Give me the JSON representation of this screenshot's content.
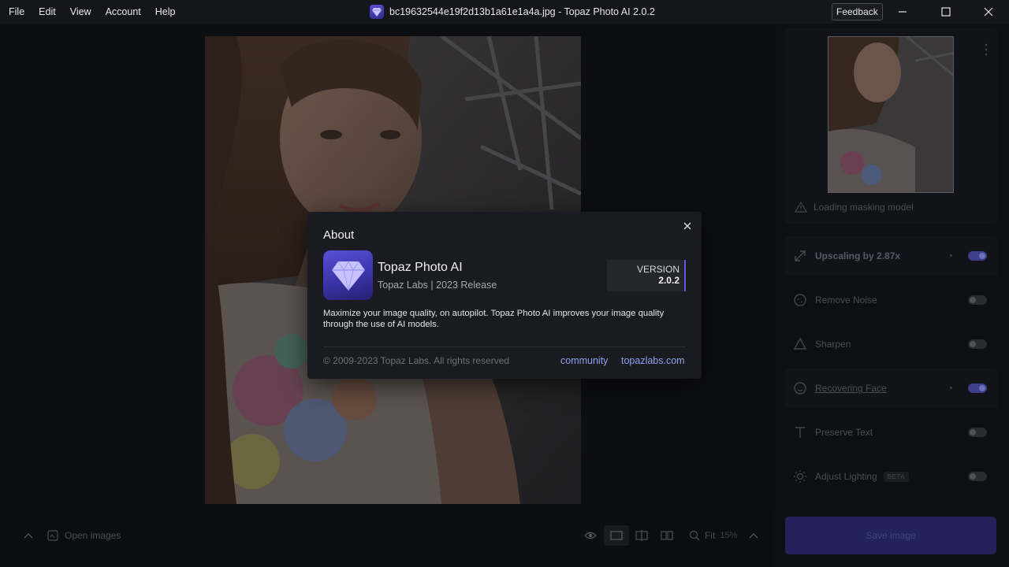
{
  "menu": [
    "File",
    "Edit",
    "View",
    "Account",
    "Help"
  ],
  "window": {
    "title": "bc19632544e19f2d13b1a61e1a4a.jpg - Topaz Photo AI 2.0.2",
    "feedback": "Feedback"
  },
  "sidebar": {
    "loading_text": "Loading masking model",
    "tools": [
      {
        "label": "Upscaling by 2.87x",
        "enabled": true
      },
      {
        "label": "Remove Noise",
        "enabled": false
      },
      {
        "label": "Sharpen",
        "enabled": false
      },
      {
        "label": "Recovering Face",
        "enabled": true
      },
      {
        "label": "Preserve Text",
        "enabled": false
      },
      {
        "label": "Adjust Lighting",
        "enabled": false,
        "badge": "BETA"
      }
    ],
    "save_label": "Save image"
  },
  "bottombar": {
    "open_images": "Open images",
    "fit_label": "Fit",
    "zoom": "15%"
  },
  "about": {
    "title": "About",
    "app_name": "Topaz Photo AI",
    "publisher": "Topaz Labs | 2023 Release",
    "version_label": "VERSION",
    "version": "2.0.2",
    "description": "Maximize your image quality, on autopilot. Topaz Photo AI improves your image quality through the use of AI models.",
    "copyright": "© 2009-2023 Topaz Labs. All rights reserved",
    "links": [
      "community",
      "topazlabs.com"
    ]
  },
  "colors": {
    "accent": "#5e5bd6",
    "link": "#8ea2ee",
    "dialog_bg": "#1a1b21"
  }
}
